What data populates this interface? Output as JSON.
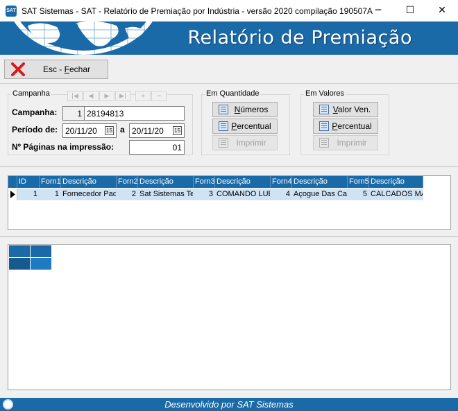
{
  "window": {
    "title": "SAT Sistemas - SAT - Relatório de Premiação por Indústria - versão 2020 compilação 190507A",
    "icon_text": "SAT",
    "controls": [
      "─",
      "☐",
      "✕"
    ]
  },
  "banner": {
    "title": "Relatório de Premiação"
  },
  "toolbar": {
    "close_label_pre": "Esc - ",
    "close_label_key": "F",
    "close_label_post": "echar"
  },
  "campanha_group": {
    "title": "Campanha",
    "nav": [
      "|◀",
      "◀",
      "▶",
      "▶|",
      "+",
      "−"
    ],
    "campanha_label": "Campanha:",
    "campanha_num": "1",
    "campanha_value": "28194813",
    "periodo_label": "Período de:",
    "date_from": "20/11/20",
    "date_sep": "a",
    "date_to": "20/11/20",
    "cal_icon": "15",
    "paginas_label": "Nº Páginas na impressão:",
    "paginas_value": "01"
  },
  "quantidade_group": {
    "title": "Em Quantidade",
    "numeros_key": "N",
    "numeros_rest": "úmeros",
    "percentual_key": "P",
    "percentual_rest": "ercentual",
    "imprimir": "Imprimir"
  },
  "valores_group": {
    "title": "Em Valores",
    "valor_key": "V",
    "valor_rest": "alor Ven.",
    "percentual_key": "P",
    "percentual_rest": "ercentual",
    "imprimir": "Imprimir"
  },
  "grid": {
    "columns": [
      "ID",
      "Forn1",
      "Descrição",
      "Forn2",
      "Descrição",
      "Forn3",
      "Descrição",
      "Forn4",
      "Descrição",
      "Forn5",
      "Descrição"
    ],
    "rows": [
      [
        "1",
        "1",
        "Fornecedor Pad",
        "2",
        "Sat Sistemas Te",
        "3",
        "COMANDO LUB",
        "4",
        "Açogue Das Ca",
        "5",
        "CALCADOS MA"
      ]
    ]
  },
  "footer": {
    "text": "Desenvolvido por SAT Sistemas"
  },
  "colors": {
    "brand": "#1a6aa8",
    "row_selected": "#cfe3f5"
  }
}
